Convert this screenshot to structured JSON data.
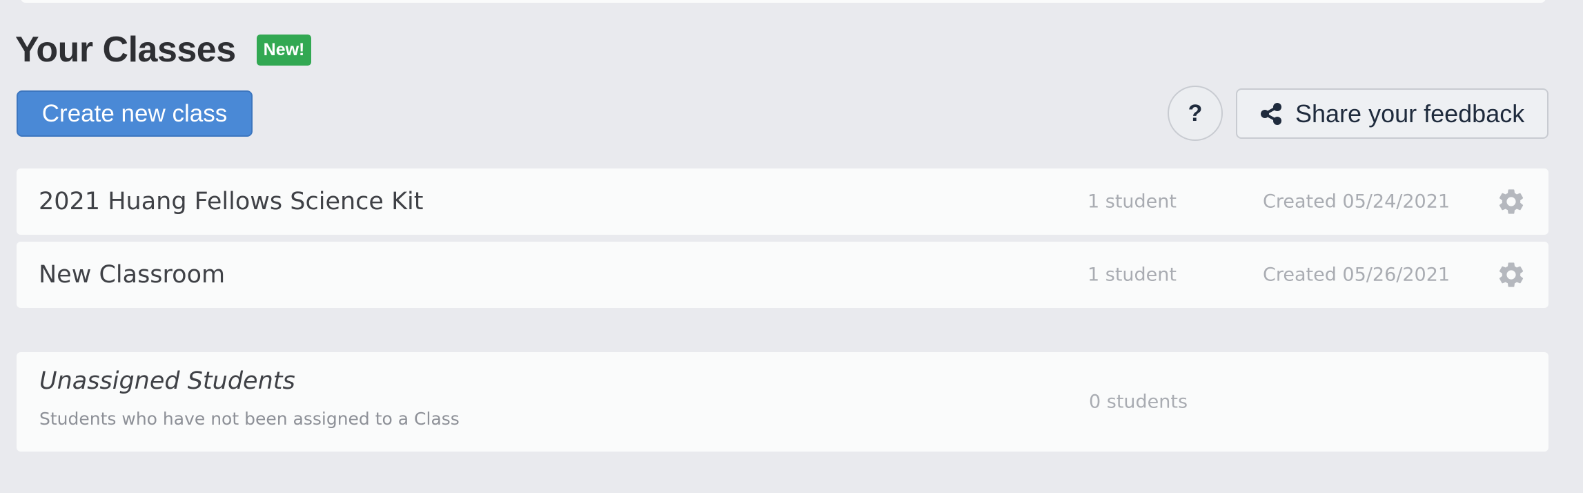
{
  "header": {
    "title": "Your Classes",
    "badge": "New!"
  },
  "toolbar": {
    "create_label": "Create new class",
    "help_label": "?",
    "feedback_label": "Share your feedback",
    "feedback_icon": "share-icon"
  },
  "classes": [
    {
      "name": "2021 Huang Fellows Science Kit",
      "count": "1 student",
      "created": "Created 05/24/2021",
      "settings_icon": "gear-icon"
    },
    {
      "name": "New Classroom",
      "count": "1 student",
      "created": "Created 05/26/2021",
      "settings_icon": "gear-icon"
    }
  ],
  "unassigned": {
    "title": "Unassigned Students",
    "description": "Students who have not been assigned to a Class",
    "count": "0 students"
  },
  "colors": {
    "background": "#e9eaee",
    "card": "#fafbfb",
    "primary_button": "#4a89d6",
    "badge": "#32a852",
    "muted_text": "#a9acb2"
  }
}
